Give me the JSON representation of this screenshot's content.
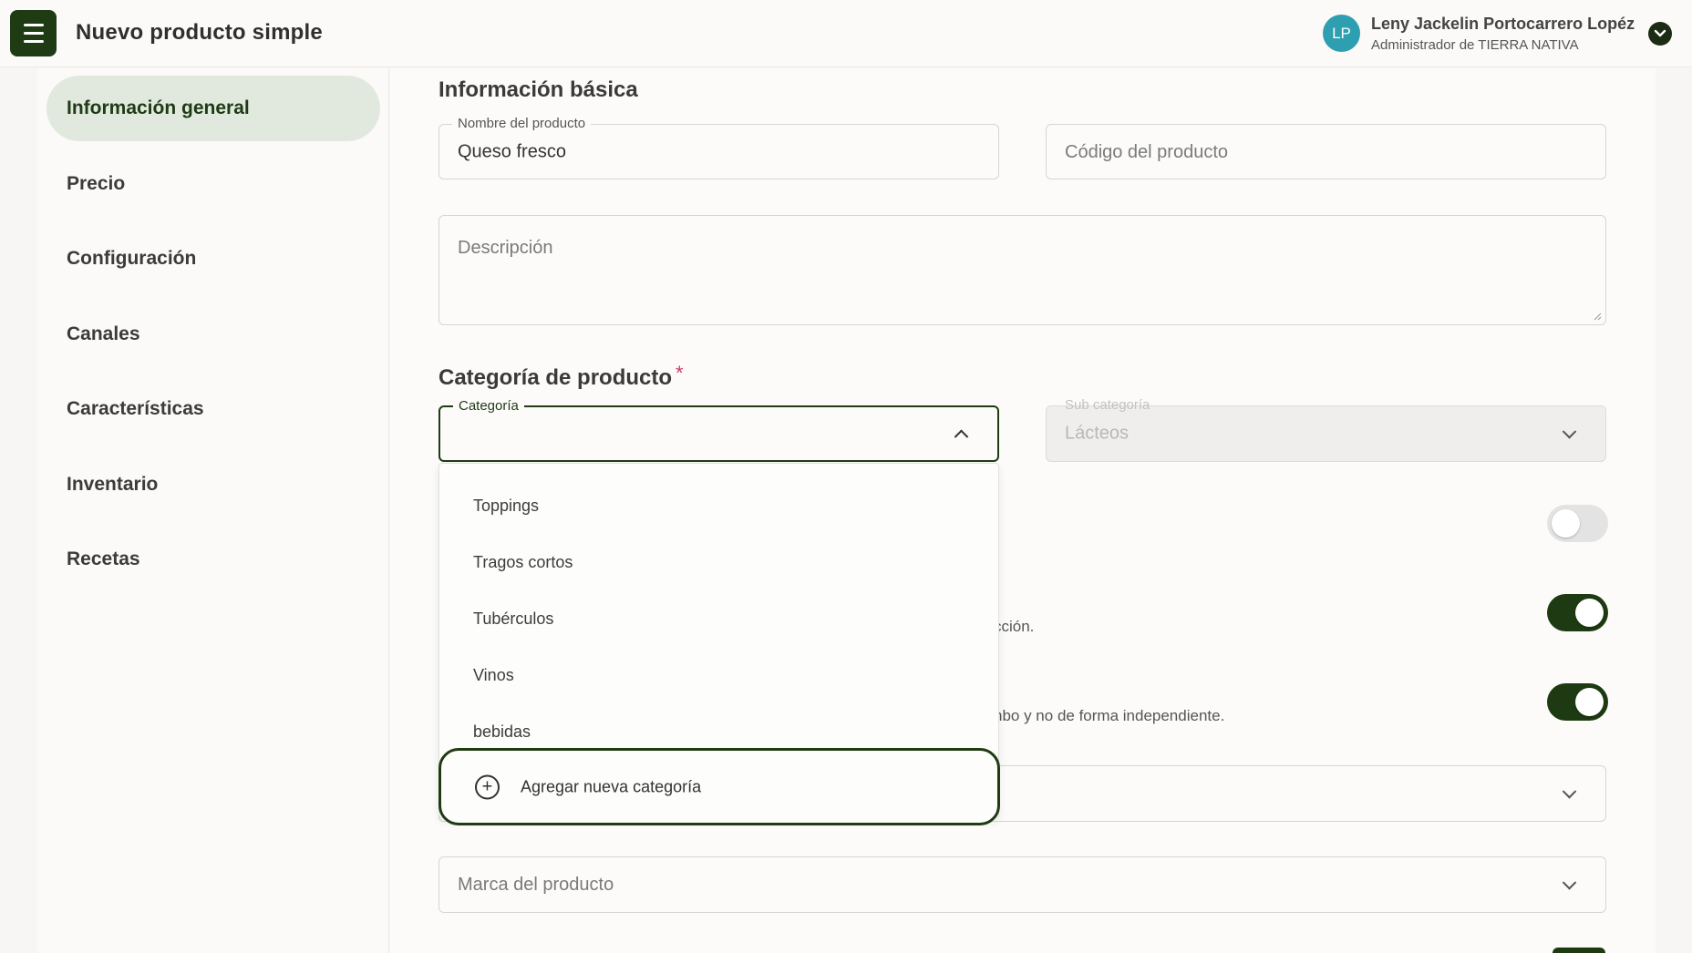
{
  "header": {
    "title": "Nuevo producto simple",
    "user": {
      "initials": "LP",
      "name": "Leny Jackelin Portocarrero Lopéz",
      "role": "Administrador de TIERRA NATIVA"
    }
  },
  "sidebar": {
    "items": [
      {
        "label": "Información general",
        "active": true
      },
      {
        "label": "Precio"
      },
      {
        "label": "Configuración"
      },
      {
        "label": "Canales"
      },
      {
        "label": "Características"
      },
      {
        "label": "Inventario"
      },
      {
        "label": "Recetas"
      }
    ]
  },
  "basic_info": {
    "section_title": "Información básica",
    "product_name": {
      "label": "Nombre del producto",
      "value": "Queso fresco"
    },
    "product_code": {
      "placeholder": "Código del producto"
    },
    "description": {
      "placeholder": "Descripción"
    }
  },
  "category": {
    "section_title": "Categoría de producto",
    "required_mark": "*",
    "category_field": {
      "label": "Categoría",
      "value": ""
    },
    "subcategory_field": {
      "label": "Sub categoría",
      "value": "Lácteos"
    },
    "options": [
      "Toppings",
      "Tragos cortos",
      "Tubérculos",
      "Vinos",
      "bebidas"
    ],
    "add_new_label": "Agregar nueva categoría"
  },
  "settings": {
    "hint_1": "cción.",
    "hint_2": "nbo y no de forma independiente.",
    "toggles": [
      {
        "on": false
      },
      {
        "on": true
      },
      {
        "on": true
      }
    ]
  },
  "brand": {
    "placeholder": "Marca del producto"
  },
  "colors": {
    "accent": "#1f3b14",
    "active_bg": "#e1e9df",
    "avatar": "#2e9fb0",
    "required": "#d23a6e"
  }
}
